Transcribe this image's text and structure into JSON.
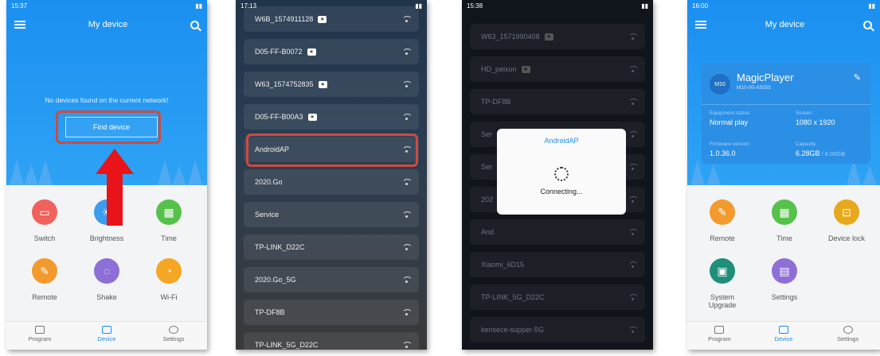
{
  "panel1": {
    "status_time": "15:37",
    "title": "My device",
    "empty_message": "No devices found on the current network!",
    "find_button": "Find device",
    "tiles": [
      {
        "label": "Switch",
        "icon": "switch-icon",
        "color": "#f0625b"
      },
      {
        "label": "Brightness",
        "icon": "brightness-icon",
        "color": "#3b9cf0"
      },
      {
        "label": "Time",
        "icon": "calendar-icon",
        "color": "#56c24b"
      },
      {
        "label": "Remote",
        "icon": "remote-icon",
        "color": "#f39a2e"
      },
      {
        "label": "Shake",
        "icon": "shake-icon",
        "color": "#8e6fd8"
      },
      {
        "label": "Wi-Fi",
        "icon": "wifi-icon",
        "color": "#f5a623"
      }
    ],
    "nav": [
      "Program",
      "Device",
      "Settings"
    ]
  },
  "panel2": {
    "status_time": "17:13",
    "networks": [
      {
        "ssid": "W6B_1574911128",
        "locked": true
      },
      {
        "ssid": "D05-FF-B0072",
        "locked": true
      },
      {
        "ssid": "W63_1574752835",
        "locked": true
      },
      {
        "ssid": "D05-FF-B00A3",
        "locked": true
      },
      {
        "ssid": "AndroidAP",
        "locked": false
      },
      {
        "ssid": "2020.Go",
        "locked": false
      },
      {
        "ssid": "Service",
        "locked": false
      },
      {
        "ssid": "TP-LINK_D22C",
        "locked": false
      },
      {
        "ssid": "2020.Go_5G",
        "locked": false
      },
      {
        "ssid": "TP-DF8B",
        "locked": false
      },
      {
        "ssid": "TP-LINK_5G_D22C",
        "locked": false
      }
    ]
  },
  "panel3": {
    "status_time": "15:38",
    "networks": [
      {
        "ssid": "W63_1571990408",
        "locked": true
      },
      {
        "ssid": "HD_peixun",
        "locked": true
      },
      {
        "ssid": "TP-DF8B",
        "locked": false
      },
      {
        "ssid": "Ser",
        "locked": false
      },
      {
        "ssid": "Ser",
        "locked": false
      },
      {
        "ssid": "202",
        "locked": false
      },
      {
        "ssid": "And",
        "locked": false
      },
      {
        "ssid": "Xiaomi_6D15",
        "locked": false
      },
      {
        "ssid": "TP-LINK_5G_D22C",
        "locked": false
      },
      {
        "ssid": "kensece-supper-5G",
        "locked": false
      }
    ],
    "dialog_title": "AndroidAP",
    "dialog_message": "Connecting..."
  },
  "panel4": {
    "status_time": "16:00",
    "title": "My device",
    "badge": "M10",
    "player_name": "MagicPlayer",
    "player_model": "M10-00-A5555",
    "equipment_status_label": "Equipment status",
    "equipment_status": "Normal play",
    "screen_label": "Screen",
    "screen": "1080 x 1920",
    "firmware_label": "Firmware version",
    "firmware": "1.0.36.0",
    "capacity_label": "Capacity",
    "capacity_used": "6.28GB",
    "capacity_total": " / 8.00GB",
    "tiles": [
      {
        "label": "Remote",
        "color": "#f39a2e"
      },
      {
        "label": "Time",
        "color": "#56c24b"
      },
      {
        "label": "Device lock",
        "color": "#e8a81c"
      },
      {
        "label": "System Upgrade",
        "color": "#1e8f7a"
      },
      {
        "label": "Settings",
        "color": "#8e6fd8"
      }
    ],
    "nav": [
      "Program",
      "Device",
      "Settings"
    ]
  }
}
